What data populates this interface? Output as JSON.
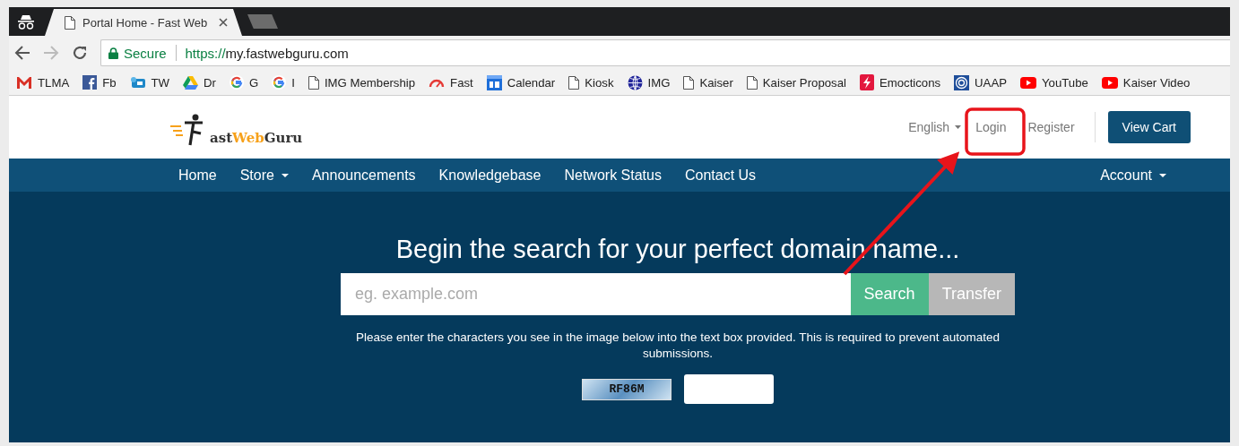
{
  "browser": {
    "tabs": [
      {
        "title": "Portal Home - Fast Web",
        "selected": true
      },
      {
        "selected": false
      }
    ],
    "address": {
      "secure_label": "Secure",
      "scheme": "https://",
      "host": "my.fastwebguru.com"
    },
    "bookmarks": [
      {
        "label": "TLMA",
        "kind": "gmail"
      },
      {
        "label": "Fb",
        "kind": "facebook"
      },
      {
        "label": "TW",
        "kind": "tw"
      },
      {
        "label": "Dr",
        "kind": "drive"
      },
      {
        "label": "G",
        "kind": "google"
      },
      {
        "label": "I",
        "kind": "google"
      },
      {
        "label": "IMG Membership",
        "kind": "page"
      },
      {
        "label": "Fast",
        "kind": "gauge"
      },
      {
        "label": "Calendar",
        "kind": "calendar"
      },
      {
        "label": "Kiosk",
        "kind": "page"
      },
      {
        "label": "IMG",
        "kind": "globe"
      },
      {
        "label": "Kaiser",
        "kind": "page"
      },
      {
        "label": "Kaiser Proposal",
        "kind": "page"
      },
      {
        "label": "Emocticons",
        "kind": "flash"
      },
      {
        "label": "UAAP",
        "kind": "target"
      },
      {
        "label": "YouTube",
        "kind": "youtube"
      },
      {
        "label": "Kaiser Video",
        "kind": "youtube"
      }
    ]
  },
  "header": {
    "logo": [
      "ast",
      "Web",
      "Guru"
    ],
    "language": "English",
    "links": [
      "Login",
      "Register"
    ],
    "cart_button": "View Cart"
  },
  "nav": {
    "items": [
      {
        "label": "Home",
        "dropdown": false
      },
      {
        "label": "Store",
        "dropdown": true
      },
      {
        "label": "Announcements",
        "dropdown": false
      },
      {
        "label": "Knowledgebase",
        "dropdown": false
      },
      {
        "label": "Network Status",
        "dropdown": false
      },
      {
        "label": "Contact Us",
        "dropdown": false
      }
    ],
    "right": {
      "label": "Account",
      "dropdown": true
    }
  },
  "hero": {
    "title": "Begin the search for your perfect domain name...",
    "search": {
      "placeholder": "eg. example.com"
    },
    "buttons": [
      "Search",
      "Transfer"
    ],
    "notice": "Please enter the characters you see in the image below into the text box provided. This is required to prevent automated submissions.",
    "captcha": "RF86M"
  }
}
